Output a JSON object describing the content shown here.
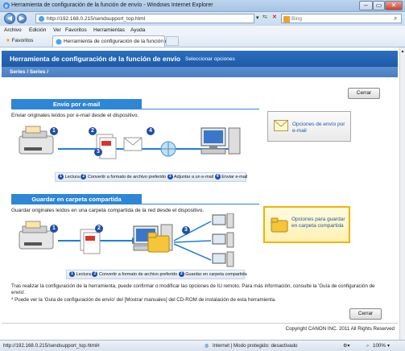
{
  "window": {
    "title": "Herramienta de configuración de la función de envío - Windows Internet Explorer",
    "minimize": "–",
    "maximize": "▭",
    "close": "✕"
  },
  "address": {
    "url": "http://192.168.0.215/sendsupport_top.html",
    "search_placeholder": "Bing"
  },
  "menu": [
    "Archivo",
    "Edición",
    "Ver",
    "Favoritos",
    "Herramientas",
    "Ayuda"
  ],
  "favorites": {
    "label": "Favoritos",
    "tab_title": "Herramienta de configuración de la función de e..."
  },
  "header": {
    "title": "Herramienta de configuración de la función de envío",
    "subtitle": "Seleccionar opciones",
    "series": "Series / Series /"
  },
  "close_label": "Cerrar",
  "email_section": {
    "title": "Envío por e-mail",
    "description": "Enviar originales leídos por e-mail desde el dispositivo.",
    "steps": [
      "Lectura",
      "Convertir a formato de archivo preferido",
      "Adjuntar a un e-mail",
      "Enviar e-mail"
    ],
    "option_label": "Opciones de envío por e-mail"
  },
  "folder_section": {
    "title": "Guardar en carpeta compartida",
    "description": "Guardar originales leídos en una carpeta compartida de la red desde el dispositivo.",
    "steps": [
      "Lectura",
      "Convertir a formato de archivo preferido",
      "Guardar en carpeta compartida"
    ],
    "option_label": "Opciones para guardar en carpeta compartida"
  },
  "notes": {
    "line1": "Tras realizar la configuración de la herramienta, puede confirmar o modificar las opciones de IU remoto. Para más información, consulte la 'Guía de configuración de envío'.",
    "line2": "* Puede ver la 'Guía de configuración de envío' del [Mostrar manuales] del CD-ROM de instalación de esta herramienta."
  },
  "copyright": "Copyright CANON INC. 2011 All Rights Reserved",
  "status": {
    "url": "http://192.168.0.215/sendsupport_top.html#",
    "zone": "Internet | Modo protegido: desactivado",
    "zoom": "100%"
  },
  "colors": {
    "accent": "#1d5aa6",
    "section": "#2d86d6",
    "highlight": "#f2b400"
  }
}
